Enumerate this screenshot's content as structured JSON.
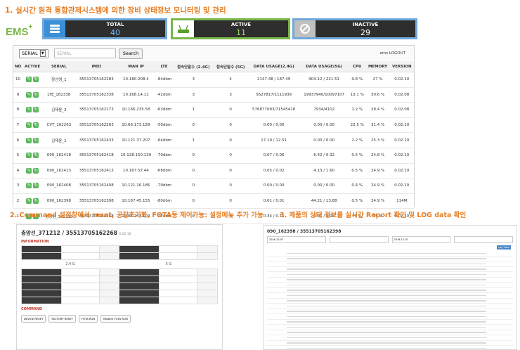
{
  "headings": {
    "h1": "1. 실시간 원격 통합관제시스템에 의한 장비 상태정보 모니터링 및 관리",
    "h2": "2. Command 설정창에서 reset, 공장초기화, FOTA등 제어가능: 설정메뉴 추가 가능",
    "h3": "3. 제품의 상태 정보를 실시간 Report 확인 및 LOG data 확인"
  },
  "logo": {
    "text": "EMS",
    "sup": "+"
  },
  "stats": {
    "total": {
      "label": "TOTAL",
      "value": "40"
    },
    "active": {
      "label": "ACTIVE",
      "value": "11"
    },
    "inactive": {
      "label": "INACTIVE",
      "value": "29"
    }
  },
  "toolbar": {
    "select_value": "SERIAL",
    "search_placeholder": "SERIAL",
    "search_button": "Search",
    "logout": "ems LOGOUT"
  },
  "columns": [
    "NO",
    "ACTIVE",
    "SERIAL",
    "IMEI",
    "WAN IP",
    "LTE",
    "접속단말수 (2.4G)",
    "접속단말수 (5G)",
    "DATA USAGE(2.4G)",
    "DATA USAGE(5G)",
    "CPU",
    "MEMORY",
    "VERSION"
  ],
  "rows": [
    [
      "10",
      "장선영_1",
      "35513705162283",
      "10.180.208.4",
      "-84dbm",
      "3",
      "4",
      "2147.48 / 187.49",
      "904.12 / 221.51",
      "9.8 %",
      "27 %",
      "0.02.10"
    ],
    [
      "9",
      "LTE_162338",
      "35513705162338",
      "10.168.14.11",
      "-42dbm",
      "3",
      "3",
      "5627817/1111939",
      "19937940/10097107",
      "13.1 %",
      "30.6 %",
      "0.02.08"
    ],
    [
      "8",
      "김재윤_2",
      "35513705162273",
      "10.166.235.58",
      "-63dbm",
      "1",
      "0",
      "576877093/71545418",
      "7934/4102",
      "1.2 %",
      "28.4 %",
      "0.02.08"
    ],
    [
      "7",
      "CVT_162263",
      "35513705162263",
      "10.66.173.158",
      "-50dbm",
      "0",
      "0",
      "0.00 / 0.00",
      "0.00 / 0.00",
      "22.5 %",
      "31.4 %",
      "0.02.10"
    ],
    [
      "6",
      "김재윤_1",
      "35513705162433",
      "10.121.37.207",
      "-64dbm",
      "1",
      "0",
      "17.19 / 12.51",
      "0.00 / 0.00",
      "2.2 %",
      "25.3 %",
      "0.02.10"
    ],
    [
      "5",
      "090_162418",
      "35513705162418",
      "10.128.150.139",
      "-70dbm",
      "0",
      "0",
      "0.07 / 0.06",
      "6.42 / 0.32",
      "0.5 %",
      "24.8 %",
      "0.02.10"
    ],
    [
      "4",
      "090_162413",
      "35513705162413",
      "10.167.57.44",
      "-68dbm",
      "0",
      "0",
      "0.05 / 0.02",
      "4.13 / 1.60",
      "0.5 %",
      "24.9 %",
      "0.02.10"
    ],
    [
      "3",
      "090_162408",
      "35513705162408",
      "10.121.16.186",
      "-79dbm",
      "0",
      "0",
      "0.00 / 0.00",
      "0.00 / 0.00",
      "0.4 %",
      "24.9 %",
      "0.02.10"
    ],
    [
      "2",
      "090_162398",
      "35513705162398",
      "10.167.45.155",
      "-80dbm",
      "0",
      "0",
      "0.01 / 0.01",
      "44.21 / 13.88",
      "0.5 %",
      "24.9 %",
      "114M"
    ],
    [
      "1",
      "충양선_371212",
      "35513705162268",
      "10.85.232.104",
      "-77dbm",
      "0",
      "0",
      "0.34 / 0.71",
      "0.01 / 0.00",
      "75 %",
      "25 %",
      "0.02.10"
    ]
  ],
  "shot_a": {
    "title": "충양선_371212 / 35513705162268",
    "version": "0.02.10",
    "information_label": "INFORMATION",
    "band_24": "2.4 G",
    "band_5": "5 G",
    "command_label": "COMMAND",
    "commands": [
      "DEVICE RESET",
      "FACTORY RESET",
      "FOTA RUN",
      "Modem FOTA RUN"
    ]
  },
  "shot_b": {
    "title": "090_162398 / 35513705162398",
    "date_start": "2016-12-07",
    "date_end": "2016-12-07",
    "log_button": "Log View"
  },
  "colors": {
    "heading": "#e67d22",
    "logo": "#7ab648",
    "total_border": "#6fa8dc",
    "active_border": "#7ab648"
  }
}
